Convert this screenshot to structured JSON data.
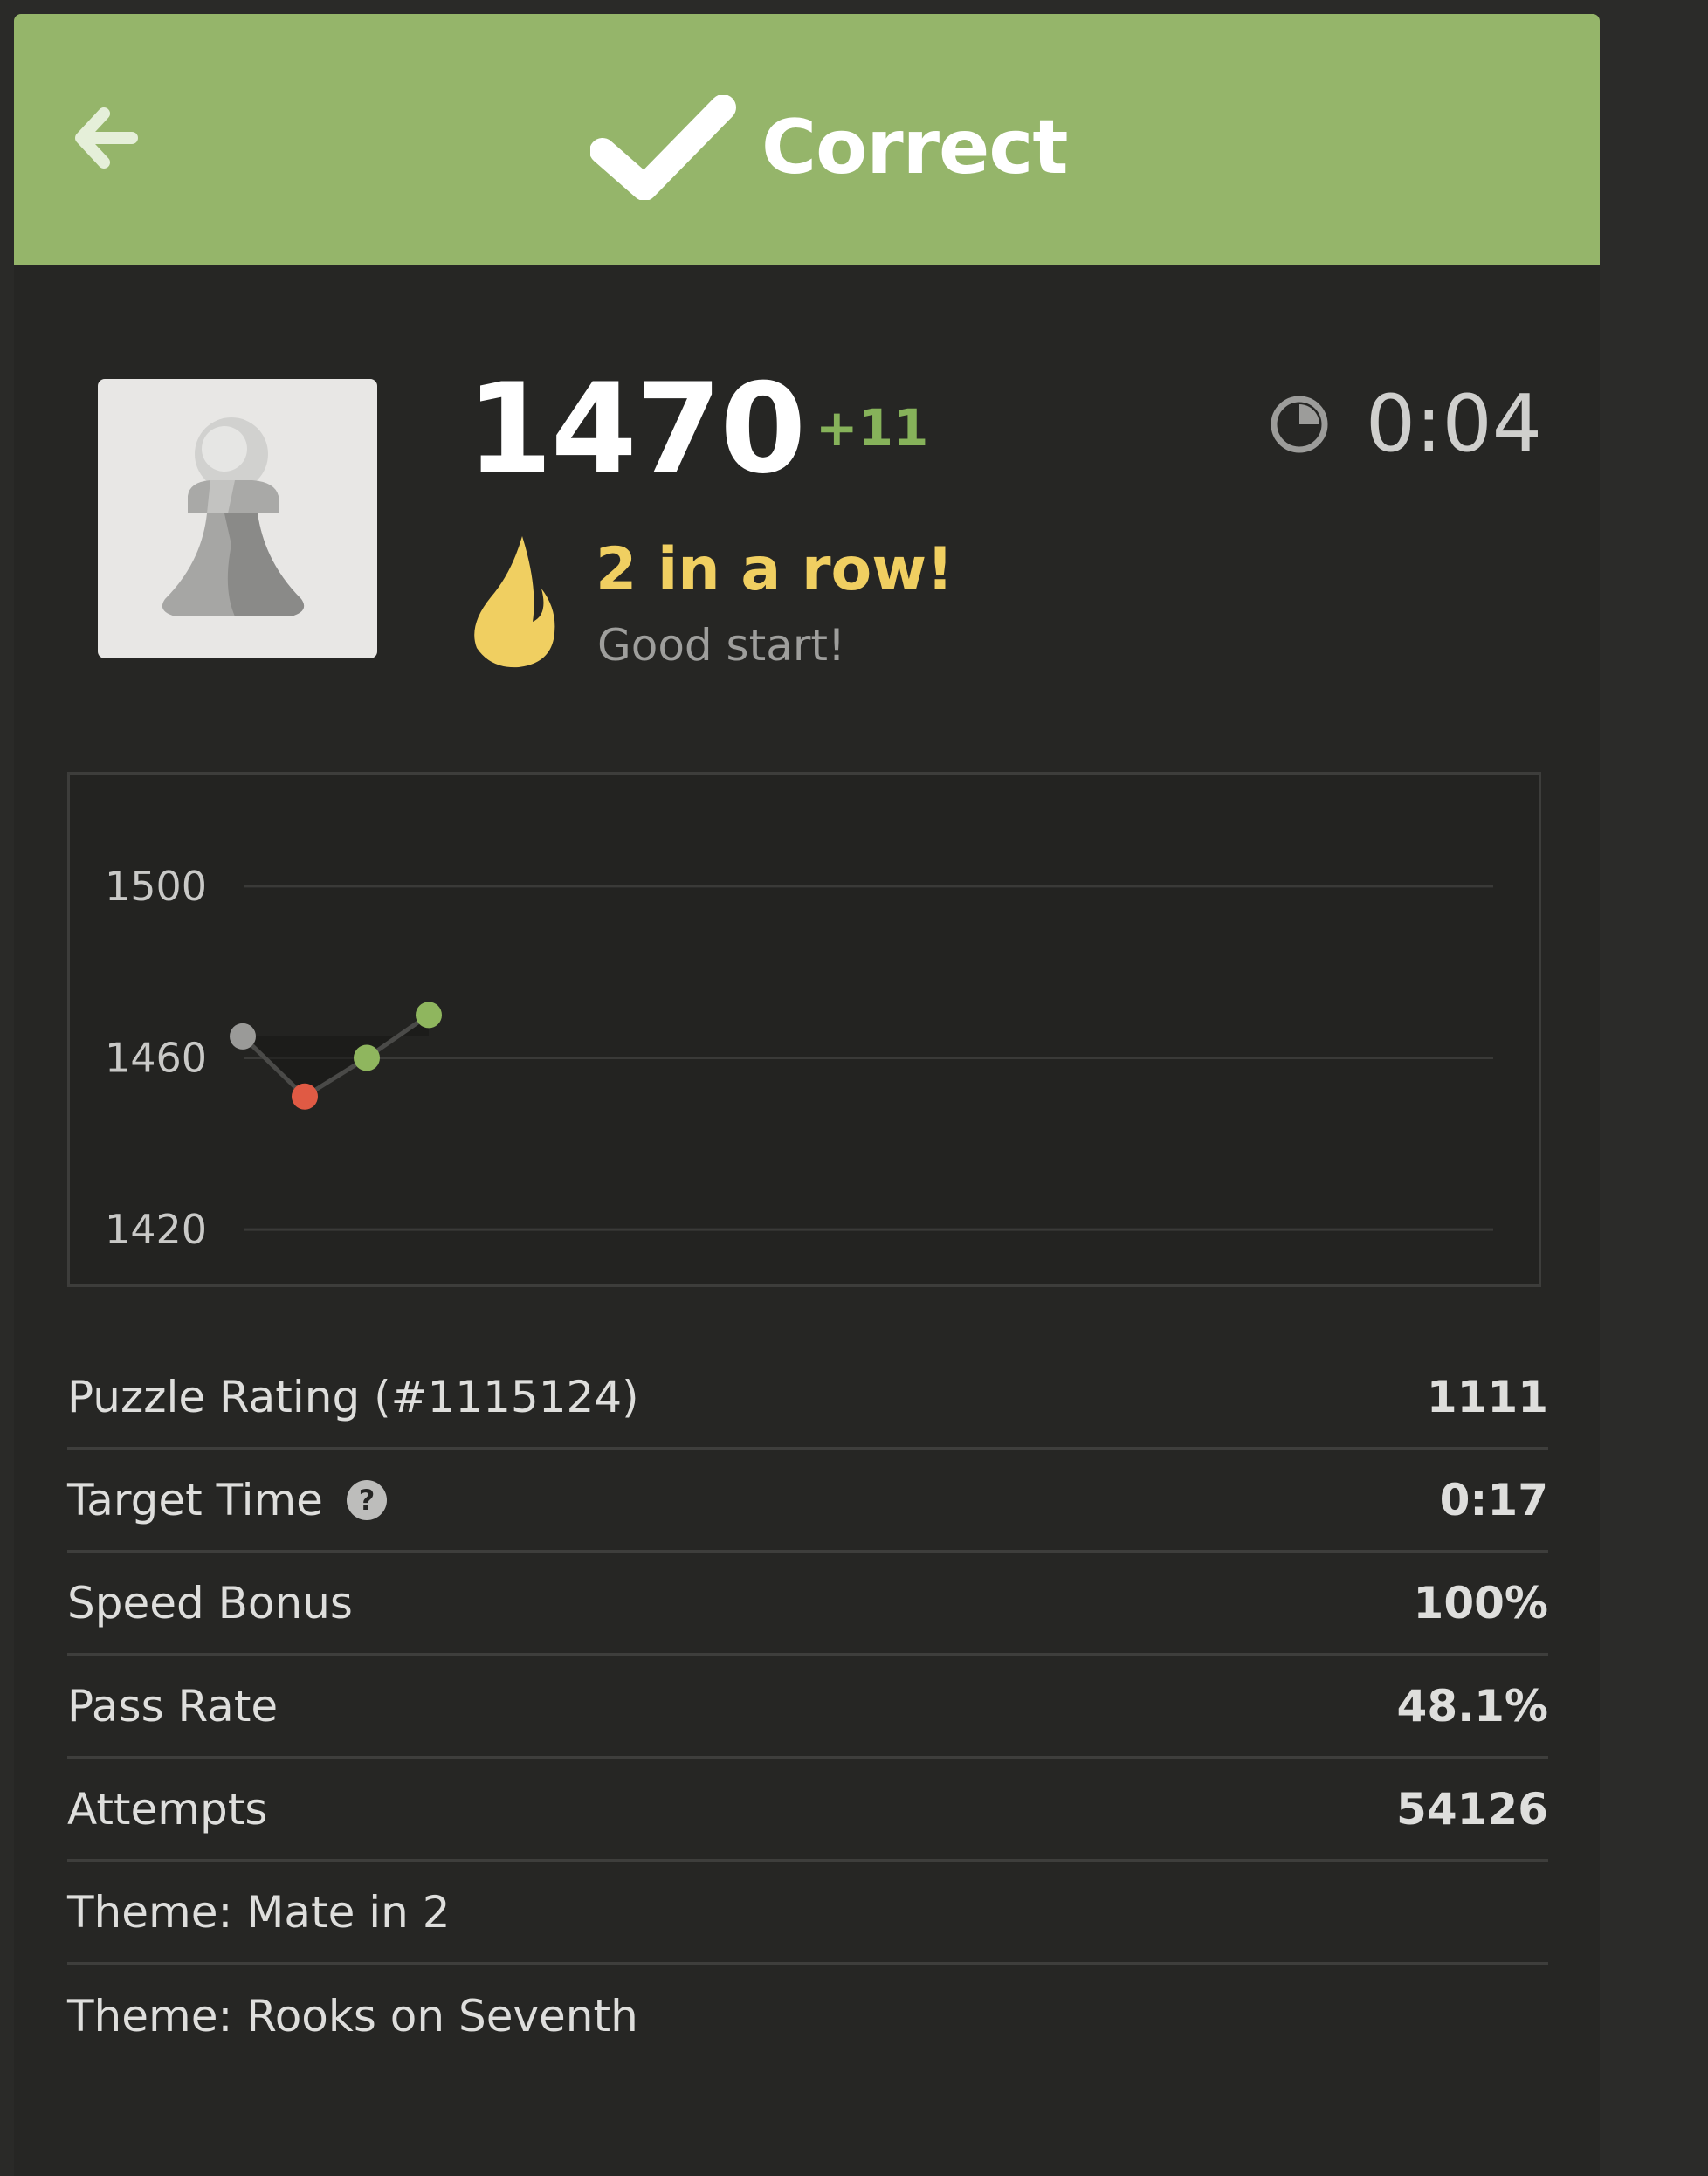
{
  "header": {
    "title": "Correct",
    "back_icon": "arrow-left-icon",
    "check_icon": "checkmark-icon",
    "color": "#95b56a"
  },
  "rating": {
    "value": "1470",
    "delta": "+11"
  },
  "timer": {
    "icon": "clock-icon",
    "value": "0:04"
  },
  "streak": {
    "icon": "flame-icon",
    "title": "2 in a row!",
    "subtitle": "Good start!"
  },
  "avatar": {
    "icon": "pawn-icon"
  },
  "chart_data": {
    "type": "line",
    "ylim": [
      1406,
      1526
    ],
    "ticks": [
      1500,
      1460,
      1420
    ],
    "tick_labels": [
      "1500",
      "1460",
      "1420"
    ],
    "grid": true,
    "x": [
      0,
      1,
      2,
      3
    ],
    "values": [
      1465,
      1451,
      1460,
      1470
    ],
    "point_colors": [
      "#9a9a98",
      "#e05a44",
      "#8fb65e",
      "#8fb65e"
    ]
  },
  "stats": [
    {
      "label": "Puzzle Rating (#1115124)",
      "value": "1111"
    },
    {
      "label": "Target Time",
      "value": "0:17",
      "help_icon": "question-icon"
    },
    {
      "label": "Speed Bonus",
      "value": "100%"
    },
    {
      "label": "Pass Rate",
      "value": "48.1%"
    },
    {
      "label": "Attempts",
      "value": "54126"
    },
    {
      "label": "Theme: Mate in 2",
      "value": ""
    },
    {
      "label": "Theme: Rooks on Seventh",
      "value": ""
    }
  ]
}
